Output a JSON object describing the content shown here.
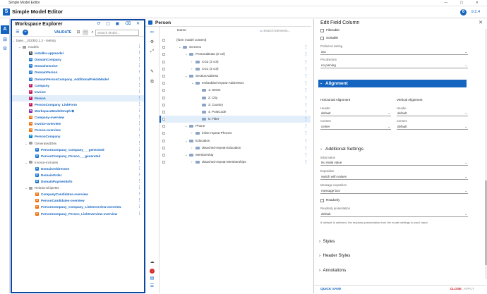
{
  "window": {
    "title": "Simple Model Editor"
  },
  "app": {
    "name": "Simple Model Editor",
    "logo_letter": "S",
    "info_badge": "6",
    "version": "9.2.4"
  },
  "rail": {
    "items": [
      "A",
      "⊞",
      "⚙"
    ]
  },
  "explorer": {
    "title": "Workspace Explorer",
    "validate_label": "VALIDATE",
    "search_placeholder": "Search Model...",
    "tree": [
      {
        "indent": 0,
        "chev": "⌄",
        "icon": "",
        "label": "base__202302.1.2 - testing",
        "style": "plain"
      },
      {
        "indent": 1,
        "chev": "⌄",
        "icon": "folder",
        "label": "models",
        "style": "plain"
      },
      {
        "indent": 2,
        "chev": "",
        "icon": "A",
        "color": "#37474f",
        "label": "installer-appmodel",
        "style": "link"
      },
      {
        "indent": 2,
        "chev": "",
        "icon": "D",
        "color": "#1976d2",
        "label": "DomainCompany",
        "style": "link"
      },
      {
        "indent": 2,
        "chev": "",
        "icon": "D",
        "color": "#1976d2",
        "label": "DomainInvoice",
        "style": "link"
      },
      {
        "indent": 2,
        "chev": "",
        "icon": "D",
        "color": "#1976d2",
        "label": "DomainPerson",
        "style": "link"
      },
      {
        "indent": 2,
        "chev": "",
        "icon": "D",
        "color": "#1976d2",
        "label": "DomainPersonCompany_AdditionalFieldsModel",
        "style": "link"
      },
      {
        "indent": 2,
        "chev": "",
        "icon": "F",
        "color": "#c2185b",
        "label": "Company",
        "style": "link"
      },
      {
        "indent": 2,
        "chev": "",
        "icon": "F",
        "color": "#c2185b",
        "label": "Invoice",
        "style": "link"
      },
      {
        "indent": 2,
        "chev": "",
        "icon": "F",
        "color": "#c2185b",
        "label": "Person",
        "style": "link",
        "selected": true
      },
      {
        "indent": 2,
        "chev": "",
        "icon": "F",
        "color": "#c2185b",
        "label": "PersonCompany_LinkForm",
        "style": "link"
      },
      {
        "indent": 2,
        "chev": "",
        "icon": "W",
        "color": "#7b1fa2",
        "label": "WorkspaceModelGraph ⧉",
        "style": "link"
      },
      {
        "indent": 2,
        "chev": "",
        "icon": "O",
        "color": "#ef6c00",
        "label": "Company-overview",
        "style": "link"
      },
      {
        "indent": 2,
        "chev": "",
        "icon": "O",
        "color": "#ef6c00",
        "label": "Invoice-overview",
        "style": "link"
      },
      {
        "indent": 2,
        "chev": "",
        "icon": "O",
        "color": "#ef6c00",
        "label": "Person-overview",
        "style": "link"
      },
      {
        "indent": 2,
        "chev": "",
        "icon": "P",
        "color": "#0288d1",
        "label": "PersonCompany",
        "style": "link"
      },
      {
        "indent": 2,
        "chev": "⌄",
        "icon": "folder",
        "label": "GeneratedDMs",
        "style": "plain"
      },
      {
        "indent": 3,
        "chev": "",
        "icon": "D",
        "color": "#1976d2",
        "label": "PersonCompany_Company___generated",
        "style": "link"
      },
      {
        "indent": 3,
        "chev": "",
        "icon": "D",
        "color": "#1976d2",
        "label": "PersonCompany_Person___generated",
        "style": "link"
      },
      {
        "indent": 2,
        "chev": "⌄",
        "icon": "folder",
        "label": "Invoice-Includes",
        "style": "plain"
      },
      {
        "indent": 3,
        "chev": "",
        "icon": "D",
        "color": "#1976d2",
        "label": "DomainAddresses",
        "style": "link"
      },
      {
        "indent": 3,
        "chev": "",
        "icon": "D",
        "color": "#1976d2",
        "label": "DomainOrder",
        "style": "link"
      },
      {
        "indent": 3,
        "chev": "",
        "icon": "D",
        "color": "#1976d2",
        "label": "DomainPaymentInfo",
        "style": "link"
      },
      {
        "indent": 2,
        "chev": "⌄",
        "icon": "folder",
        "label": "RelationshipDMs",
        "style": "plain"
      },
      {
        "indent": 3,
        "chev": "",
        "icon": "O",
        "color": "#ef6c00",
        "label": "CompanyCandidates-overview",
        "style": "link"
      },
      {
        "indent": 3,
        "chev": "",
        "icon": "O",
        "color": "#ef6c00",
        "label": "PersonCandidates-overview",
        "style": "link"
      },
      {
        "indent": 3,
        "chev": "",
        "icon": "O",
        "color": "#ef6c00",
        "label": "PersonCompany_Company_LinkOverview-overview",
        "style": "link"
      },
      {
        "indent": 3,
        "chev": "",
        "icon": "O",
        "color": "#ef6c00",
        "label": "PersonCompany_Person_LinkOverview-overview",
        "style": "link"
      }
    ]
  },
  "editor": {
    "tab_title": "Person",
    "column_header": "Name",
    "search_placeholder": "Search Elements...",
    "rows": [
      {
        "indent": 0,
        "chev": "",
        "label": "(form model content)",
        "icon": false
      },
      {
        "indent": 1,
        "chev": "⌄",
        "label": "Screen1",
        "icon": true
      },
      {
        "indent": 2,
        "chev": "⌄",
        "label": "PersonalData (2 col)",
        "icon": true
      },
      {
        "indent": 3,
        "chev": "›",
        "label": "CG2 (2 col)",
        "icon": true
      },
      {
        "indent": 3,
        "chev": "›",
        "label": "CG1 (2 col)",
        "icon": true
      },
      {
        "indent": 2,
        "chev": "⌄",
        "label": "SectionAddress",
        "icon": true
      },
      {
        "indent": 3,
        "chev": "⌄",
        "label": "embedded-repeat-Addresses",
        "icon": true
      },
      {
        "indent": 4,
        "chev": "",
        "label": "1: Street",
        "icon": true
      },
      {
        "indent": 4,
        "chev": "",
        "label": "2: City",
        "icon": true
      },
      {
        "indent": 4,
        "chev": "",
        "label": "3: Country",
        "icon": true
      },
      {
        "indent": 4,
        "chev": "",
        "label": "4: PostCode",
        "icon": true
      },
      {
        "indent": 4,
        "chev": "",
        "label": "5: Filter",
        "icon": true,
        "selected": true
      },
      {
        "indent": 2,
        "chev": "⌄",
        "label": "Phone",
        "icon": true
      },
      {
        "indent": 3,
        "chev": "›",
        "label": "inline-repeat-Phones",
        "icon": true
      },
      {
        "indent": 2,
        "chev": "⌄",
        "label": "Education",
        "icon": true
      },
      {
        "indent": 3,
        "chev": "›",
        "label": "detached-repeat-Education",
        "icon": true
      },
      {
        "indent": 2,
        "chev": "⌄",
        "label": "Membership",
        "icon": true
      },
      {
        "indent": 3,
        "chev": "›",
        "label": "detached-repeat-Memberships",
        "icon": true
      }
    ]
  },
  "props": {
    "title": "Edit Field Column",
    "filterable_label": "Filterable",
    "sortable_label": "Sortable",
    "preferred_sorting_label": "Preferred sorting",
    "preferred_sorting_value": "asc",
    "pin_direction_label": "Pin direction",
    "pin_direction_value": "no pinning",
    "alignment_title": "Alignment",
    "horizontal_alignment": "Horizontal Alignment",
    "vertical_alignment": "Vertical Alignment",
    "h_header_label": "Header",
    "h_header_value": "default",
    "h_content_label": "Content",
    "h_content_value": "center",
    "v_header_label": "Header",
    "v_header_value": "default",
    "v_content_label": "Content",
    "v_content_value": "default",
    "additional_title": "Additional Settings",
    "initial_value_label": "Initial value",
    "initial_value_value": "No initial value",
    "exposition_label": "Exposition",
    "exposition_value": "switch with values",
    "message_exposition_label": "Message exposition",
    "message_exposition_value": "message box",
    "readonly_label": "Readonly",
    "readonly_presentation_label": "Readonly presentation",
    "readonly_presentation_value": "default",
    "readonly_note": "If 'default' is selected, the readonly presentation from the model settings is used: input",
    "styles": "Styles",
    "header_styles": "Header Styles",
    "annotations": "Annotations",
    "quick_save": "QUICK SAVE",
    "close": "CLOSE",
    "apply": "APPLY"
  }
}
